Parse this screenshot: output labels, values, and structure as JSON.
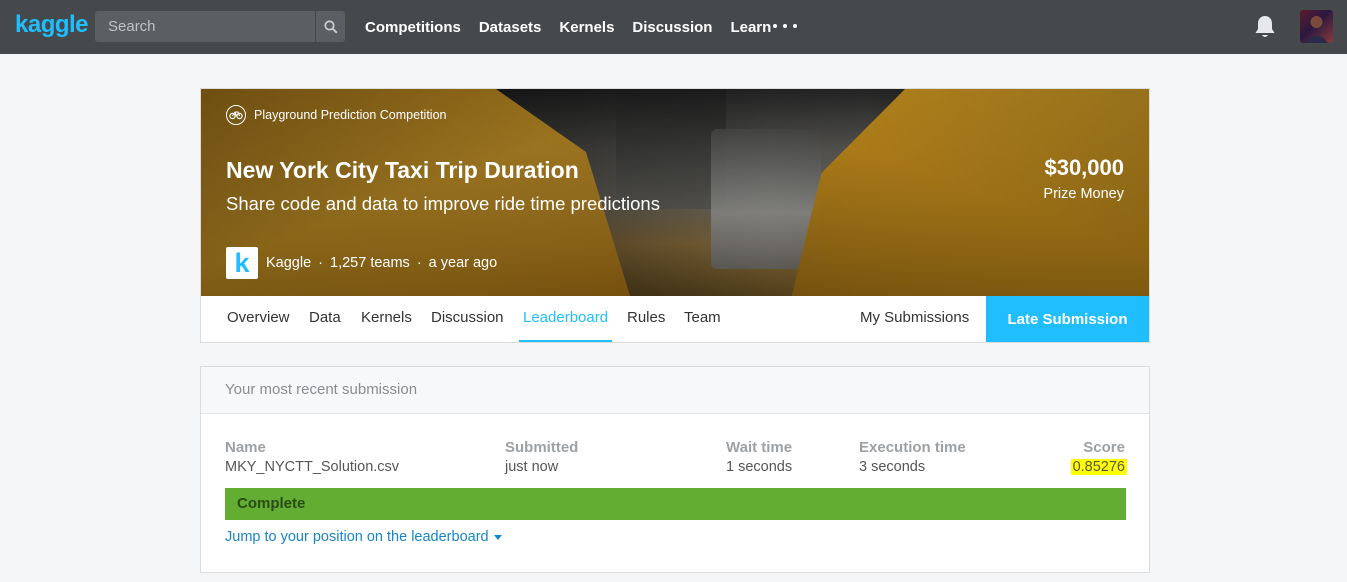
{
  "nav": {
    "logo": "kaggle",
    "search_placeholder": "Search",
    "links": [
      "Competitions",
      "Datasets",
      "Kernels",
      "Discussion",
      "Learn"
    ],
    "more_icon": "ellipsis-icon",
    "notifications_icon": "bell-icon",
    "avatar": "user-avatar"
  },
  "competition": {
    "type": "Playground Prediction Competition",
    "title": "New York City Taxi Trip Duration",
    "subtitle": "Share code and data to improve ride time predictions",
    "prize_amount": "$30,000",
    "prize_label": "Prize Money",
    "host_logo_letter": "k",
    "host": "Kaggle",
    "teams": "1,257 teams",
    "time_ago": "a year ago",
    "separator": "·",
    "tabs": [
      "Overview",
      "Data",
      "Kernels",
      "Discussion",
      "Leaderboard",
      "Rules",
      "Team"
    ],
    "active_tab": "Leaderboard",
    "my_submissions": "My Submissions",
    "late_submission": "Late Submission"
  },
  "submission": {
    "header": "Your most recent submission",
    "columns": {
      "name": "Name",
      "submitted": "Submitted",
      "wait_time": "Wait time",
      "execution_time": "Execution time",
      "score": "Score"
    },
    "values": {
      "name": "MKY_NYCTT_Solution.csv",
      "submitted": "just now",
      "wait_time": "1 seconds",
      "execution_time": "3 seconds",
      "score": "0.85276"
    },
    "status": "Complete",
    "status_color": "#63ad33",
    "jump_link": "Jump to your position on the leaderboard"
  },
  "colors": {
    "accent": "#20beff",
    "nav_bg": "#46494c",
    "score_highlight": "#ffff00"
  }
}
